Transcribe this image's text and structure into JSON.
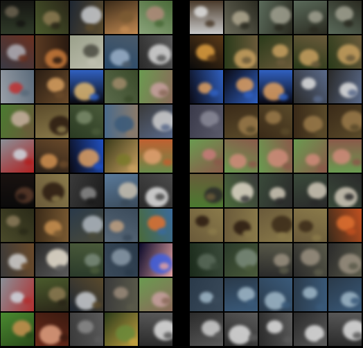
{
  "panels": [
    {
      "id": "left",
      "rows": [
        [
          [
            "#2f3a28",
            "#6b6250",
            "#151512"
          ],
          [
            "#4a5a2c",
            "#8c7a52",
            "#2a2618"
          ],
          [
            "#1e2733",
            "#c9ccd1",
            "#5a4a2c"
          ],
          [
            "#3a2a18",
            "#7a5a32",
            "#c28a52"
          ],
          [
            "#8aa37a",
            "#b08a7a",
            "#4a6a38"
          ]
        ],
        [
          [
            "#3a3a44",
            "#b0b0b8",
            "#6a3020"
          ],
          [
            "#5a3a22",
            "#c87a3a",
            "#2a1a10"
          ],
          [
            "#9aa08a",
            "#4a4a40",
            "#c0c0b0"
          ],
          [
            "#2a4a6a",
            "#9ab0c8",
            "#4a5a6a"
          ],
          [
            "#2a2a2a",
            "#d8d8d8",
            "#5a5a5a"
          ]
        ],
        [
          [
            "#9aa0a8",
            "#c03030",
            "#5a6a7a"
          ],
          [
            "#2a1e14",
            "#d8a060",
            "#6a4a2a"
          ],
          [
            "#0a0a10",
            "#e0b870",
            "#3060c0"
          ],
          [
            "#5a6a4a",
            "#a08a6a",
            "#3a4a2a"
          ],
          [
            "#6a9a50",
            "#c8a0a0",
            "#8a6a5a"
          ]
        ],
        [
          [
            "#4a7a30",
            "#c8b0a0",
            "#6a5a3a"
          ],
          [
            "#5a4a2a",
            "#2a1a10",
            "#8a7a4a"
          ],
          [
            "#2a3a22",
            "#7a8a6a",
            "#4a5a3a"
          ],
          [
            "#4a6a8a",
            "#3a5a7a",
            "#8a7a6a"
          ],
          [
            "#3a3a3a",
            "#cfcfcf",
            "#5a6a8a"
          ]
        ],
        [
          [
            "#8a9098",
            "#d0d8e0",
            "#b02020"
          ],
          [
            "#2a2018",
            "#d09050",
            "#6a4a2a"
          ],
          [
            "#0a0a14",
            "#e0a060",
            "#2050c0"
          ],
          [
            "#3a3a1a",
            "#7a7a2a",
            "#c8a060"
          ],
          [
            "#6a8a4a",
            "#e0a070",
            "#c06030"
          ]
        ],
        [
          [
            "#0a0a0a",
            "#5a3a2a",
            "#1a1210"
          ],
          [
            "#6a5a3a",
            "#2a1a10",
            "#8a7a4a"
          ],
          [
            "#3a3a3a",
            "#8a8a8a",
            "#1a1a1a"
          ],
          [
            "#5a7a9a",
            "#c8c0b0",
            "#3a4a5a"
          ],
          [
            "#2a2a2a",
            "#e0e0e0",
            "#4a4a4a"
          ]
        ],
        [
          [
            "#4a4a2a",
            "#8a7a5a",
            "#2a2a18"
          ],
          [
            "#3a2a18",
            "#c89050",
            "#7a5a32"
          ],
          [
            "#2a3a4a",
            "#b0b8c0",
            "#4a4a3a"
          ],
          [
            "#5a6a7a",
            "#c0a080",
            "#3a4a5a"
          ],
          [
            "#4a6a3a",
            "#e07030",
            "#3a6a9a"
          ]
        ],
        [
          [
            "#3a3a3a",
            "#d0d0d0",
            "#6a4a2a"
          ],
          [
            "#2a2a2a",
            "#e8e0d0",
            "#5a5a5a"
          ],
          [
            "#2a3a2a",
            "#7a8a7a",
            "#4a5a3a"
          ],
          [
            "#3a4a5a",
            "#8a9aa8",
            "#2a3a4a"
          ],
          [
            "#0a0a2a",
            "#4060e0",
            "#e0a0a0"
          ]
        ],
        [
          [
            "#8a9098",
            "#d0d8e0",
            "#b03030"
          ],
          [
            "#4a5a2c",
            "#8c7a52",
            "#2a2618"
          ],
          [
            "#1e2733",
            "#c9ccd1",
            "#5a4a2c"
          ],
          [
            "#3a3a3a",
            "#9a8a7a",
            "#5a5a4a"
          ],
          [
            "#6a9a50",
            "#c8a0a0",
            "#8a6a5a"
          ]
        ],
        [
          [
            "#4a8a30",
            "#c89050",
            "#2a4a1a"
          ],
          [
            "#6a2a1a",
            "#e0a080",
            "#3a1a10"
          ],
          [
            "#3a3a3a",
            "#8a8a8a",
            "#5a5a5a"
          ],
          [
            "#2a3a1a",
            "#6a8a3a",
            "#c0a040"
          ],
          [
            "#2a2a2a",
            "#e0e0e0",
            "#5a5a5a"
          ]
        ]
      ]
    },
    {
      "id": "right",
      "rows": [
        [
          [
            "#c8c8c8",
            "#e0e0e0",
            "#4a3a2a"
          ],
          [
            "#6a6a5a",
            "#b0a890",
            "#2a2a20"
          ],
          [
            "#5a6a5a",
            "#a0a090",
            "#2a2a20"
          ],
          [
            "#5a6a5a",
            "#a0a090",
            "#2a2a20"
          ],
          [
            "#5a6a5a",
            "#a0a090",
            "#2a2a20"
          ]
        ],
        [
          [
            "#0a0a0a",
            "#e0a040",
            "#5a3a18"
          ],
          [
            "#2a3a1a",
            "#c8a060",
            "#6a5a3a"
          ],
          [
            "#2a3a1a",
            "#c8a060",
            "#6a5a3a"
          ],
          [
            "#2a3a1a",
            "#c8a060",
            "#6a5a3a"
          ],
          [
            "#2a3a1a",
            "#c8a060",
            "#6a5a3a"
          ]
        ],
        [
          [
            "#0a0a14",
            "#e0a060",
            "#3060c0"
          ],
          [
            "#0a0a14",
            "#e0a060",
            "#3060c0"
          ],
          [
            "#0a0a14",
            "#e0a060",
            "#3060c0"
          ],
          [
            "#2a2a2a",
            "#e0e0e0",
            "#5a6a8a"
          ],
          [
            "#2a2a2a",
            "#e0e0e0",
            "#5a6a8a"
          ]
        ],
        [
          [
            "#3a3a4a",
            "#8a8a98",
            "#5a5a6a"
          ],
          [
            "#3a2a18",
            "#9a7a4a",
            "#5a4a2a"
          ],
          [
            "#3a2a18",
            "#9a7a4a",
            "#5a4a2a"
          ],
          [
            "#3a2a18",
            "#9a7a4a",
            "#5a4a2a"
          ],
          [
            "#3a2a18",
            "#9a7a4a",
            "#5a4a2a"
          ]
        ],
        [
          [
            "#6a9a50",
            "#c87a7a",
            "#8a5a4a"
          ],
          [
            "#6a9a50",
            "#d08a7a",
            "#8a5a4a"
          ],
          [
            "#6a9a50",
            "#d08a7a",
            "#8a5a4a"
          ],
          [
            "#6a9a50",
            "#d08a7a",
            "#8a5a4a"
          ],
          [
            "#6a9a50",
            "#d08a7a",
            "#8a5a4a"
          ]
        ],
        [
          [
            "#4a7a30",
            "#2a2a2a",
            "#6a5a3a"
          ],
          [
            "#4a6a3a",
            "#e0d8c8",
            "#3a3a3a"
          ],
          [
            "#3a4a3a",
            "#d0c8b8",
            "#2a2a2a"
          ],
          [
            "#3a4a3a",
            "#d0c8b8",
            "#2a2a2a"
          ],
          [
            "#3a4a3a",
            "#d0c8b8",
            "#2a2a2a"
          ]
        ],
        [
          [
            "#6a5a3a",
            "#2a1a10",
            "#8a7a4a"
          ],
          [
            "#6a5a3a",
            "#2a1a10",
            "#8a7a4a"
          ],
          [
            "#6a5a3a",
            "#3a2a18",
            "#8a7a4a"
          ],
          [
            "#6a5a3a",
            "#3a2a18",
            "#8a7a4a"
          ],
          [
            "#3a2a1a",
            "#e07030",
            "#c05020"
          ]
        ],
        [
          [
            "#1a2a1a",
            "#5a6a5a",
            "#3a4a3a"
          ],
          [
            "#2a3a2a",
            "#7a8a7a",
            "#4a5a3a"
          ],
          [
            "#2a2a2a",
            "#9a9080",
            "#5a5a4a"
          ],
          [
            "#2a2a2a",
            "#9a9080",
            "#5a5a4a"
          ],
          [
            "#2a2a2a",
            "#9a9080",
            "#5a5a4a"
          ]
        ],
        [
          [
            "#2a3a4a",
            "#a0b8c8",
            "#3a4a5a"
          ],
          [
            "#2a3a4a",
            "#a0b8c8",
            "#3a5a7a"
          ],
          [
            "#2a3a4a",
            "#a0b8c8",
            "#3a5a7a"
          ],
          [
            "#2a3a4a",
            "#a0b8c8",
            "#3a5a7a"
          ],
          [
            "#2a3a4a",
            "#a0b8c8",
            "#3a5a7a"
          ]
        ],
        [
          [
            "#2a2a2a",
            "#d0d0d0",
            "#5a5a5a"
          ],
          [
            "#2a2a2a",
            "#e0e0e0",
            "#5a5a5a"
          ],
          [
            "#2a2a2a",
            "#e0e0e0",
            "#5a5a5a"
          ],
          [
            "#2a2a2a",
            "#e0e0e0",
            "#5a5a5a"
          ],
          [
            "#2a2a2a",
            "#e0e0e0",
            "#5a5a5a"
          ]
        ]
      ]
    }
  ]
}
